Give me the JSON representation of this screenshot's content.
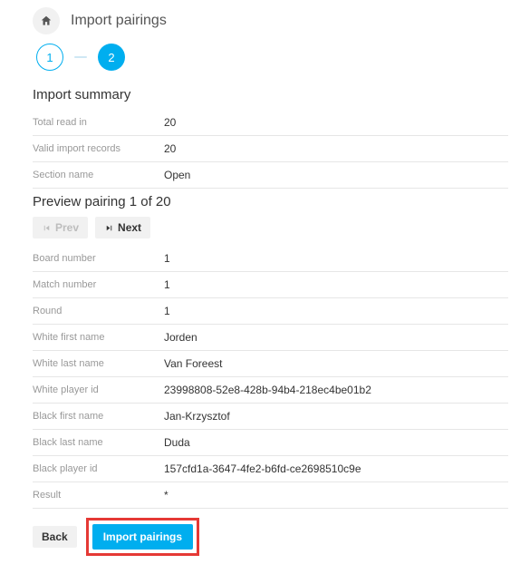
{
  "title": "Import pairings",
  "stepper": {
    "step1": "1",
    "step2": "2"
  },
  "summary_heading": "Import summary",
  "summary": [
    {
      "label": "Total read in",
      "value": "20"
    },
    {
      "label": "Valid import records",
      "value": "20"
    },
    {
      "label": "Section name",
      "value": "Open"
    }
  ],
  "preview_heading": "Preview pairing 1 of 20",
  "nav": {
    "prev": "Prev",
    "next": "Next"
  },
  "details": [
    {
      "label": "Board number",
      "value": "1"
    },
    {
      "label": "Match number",
      "value": "1"
    },
    {
      "label": "Round",
      "value": "1"
    },
    {
      "label": "White first name",
      "value": "Jorden"
    },
    {
      "label": "White last name",
      "value": "Van Foreest"
    },
    {
      "label": "White player id",
      "value": "23998808-52e8-428b-94b4-218ec4be01b2"
    },
    {
      "label": "Black first name",
      "value": "Jan-Krzysztof"
    },
    {
      "label": "Black last name",
      "value": "Duda"
    },
    {
      "label": "Black player id",
      "value": "157cfd1a-3647-4fe2-b6fd-ce2698510c9e"
    },
    {
      "label": "Result",
      "value": "*"
    }
  ],
  "actions": {
    "back": "Back",
    "import": "Import pairings"
  }
}
